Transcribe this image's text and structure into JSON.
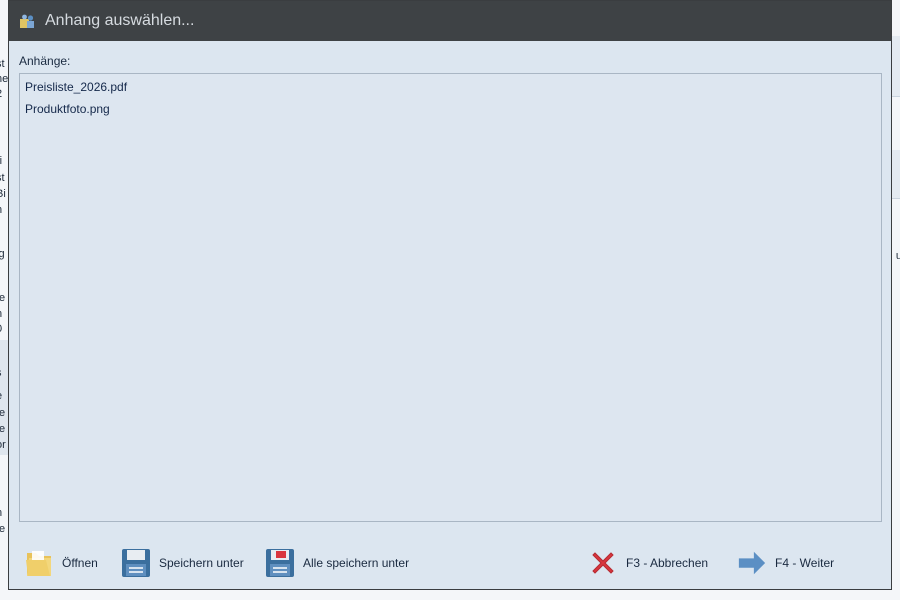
{
  "dialog": {
    "title": "Anhang auswählen...",
    "list_label": "Anhänge:",
    "attachments": [
      "Preisliste_2026.pdf",
      "Produktfoto.png"
    ]
  },
  "actions": {
    "open": "Öffnen",
    "save_as": "Speichern unter",
    "save_all_as": "Alle speichern unter",
    "cancel": "F3 - Abbrechen",
    "next": "F4 - Weiter"
  },
  "background": {
    "left_fragments": [
      "st",
      "ne",
      "2",
      "ri",
      "st",
      "Bi",
      "n",
      "ig",
      "r",
      "te",
      "n",
      "0",
      "s",
      "e",
      "te",
      "te",
      "or",
      "n",
      "te"
    ],
    "right_fragments": [
      "u"
    ]
  },
  "colors": {
    "titlebar": "#3e4245",
    "dialog_bg": "#dce6f0",
    "cancel_red": "#d9363e",
    "next_blue": "#5b8fc4"
  }
}
